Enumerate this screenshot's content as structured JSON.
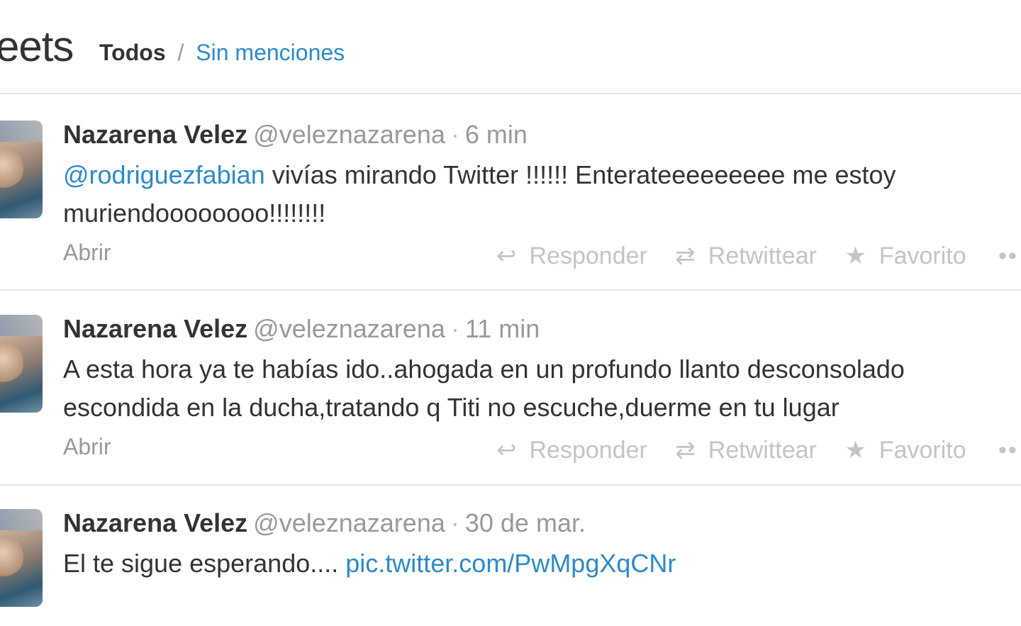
{
  "header": {
    "title": "eets",
    "filter_active": "Todos",
    "filter_separator": "/",
    "filter_link": "Sin menciones"
  },
  "tweets": [
    {
      "name": "Nazarena Velez",
      "handle": "@veleznazarena",
      "dot": "·",
      "time": "6 min",
      "mention": "@rodriguezfabian",
      "text": " vivías mirando Twitter !!!!!! Enterateeeeeeeee me estoy muriendoooooooo!!!!!!!!",
      "link": "",
      "open_label": "Abrir",
      "actions": {
        "reply": "Responder",
        "retweet": "Retwittear",
        "favorite": "Favorito",
        "more": "••"
      }
    },
    {
      "name": "Nazarena Velez",
      "handle": "@veleznazarena",
      "dot": "·",
      "time": "11 min",
      "mention": "",
      "text": "A esta hora ya te habías ido..ahogada en un profundo llanto desconsolado escondida en la ducha,tratando q Titi no escuche,duerme en tu lugar",
      "link": "",
      "open_label": "Abrir",
      "actions": {
        "reply": "Responder",
        "retweet": "Retwittear",
        "favorite": "Favorito",
        "more": "••"
      }
    },
    {
      "name": "Nazarena Velez",
      "handle": "@veleznazarena",
      "dot": "·",
      "time": "30 de mar.",
      "mention": "",
      "text": "El te sigue esperando.... ",
      "link": "pic.twitter.com/PwMpgXqCNr",
      "open_label": "",
      "actions": {}
    }
  ],
  "icons": {
    "reply": "reply-arrow-icon",
    "retweet": "retweet-icon",
    "favorite": "star-icon",
    "more": "more-dots-icon"
  },
  "colors": {
    "link": "#2b8bc9",
    "muted": "#999999",
    "action": "#c4c4c4",
    "text": "#333333"
  }
}
